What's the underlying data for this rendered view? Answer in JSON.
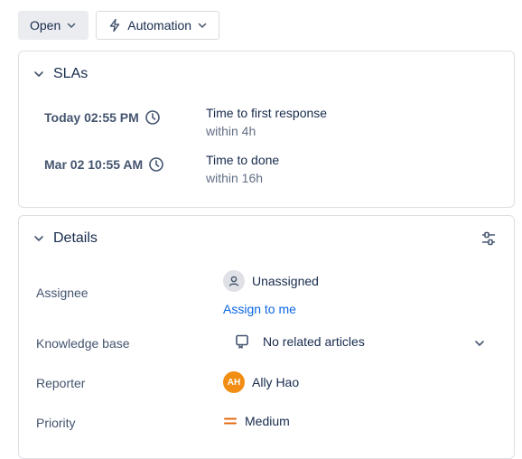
{
  "toolbar": {
    "status_label": "Open",
    "automation_label": "Automation"
  },
  "sla": {
    "title": "SLAs",
    "items": [
      {
        "date": "Today 02:55 PM",
        "label": "Time to first response",
        "sub": "within 4h"
      },
      {
        "date": "Mar 02 10:55 AM",
        "label": "Time to done",
        "sub": "within 16h"
      }
    ]
  },
  "details": {
    "title": "Details",
    "assignee": {
      "label": "Assignee",
      "value": "Unassigned",
      "action": "Assign to me"
    },
    "knowledge_base": {
      "label": "Knowledge base",
      "value": "No related articles"
    },
    "reporter": {
      "label": "Reporter",
      "initials": "AH",
      "value": "Ally Hao",
      "avatar_color": "#f18d13"
    },
    "priority": {
      "label": "Priority",
      "value": "Medium",
      "color": "#e56910"
    }
  },
  "colors": {
    "link": "#0c66e4",
    "status_bg": "#ebecf0"
  }
}
